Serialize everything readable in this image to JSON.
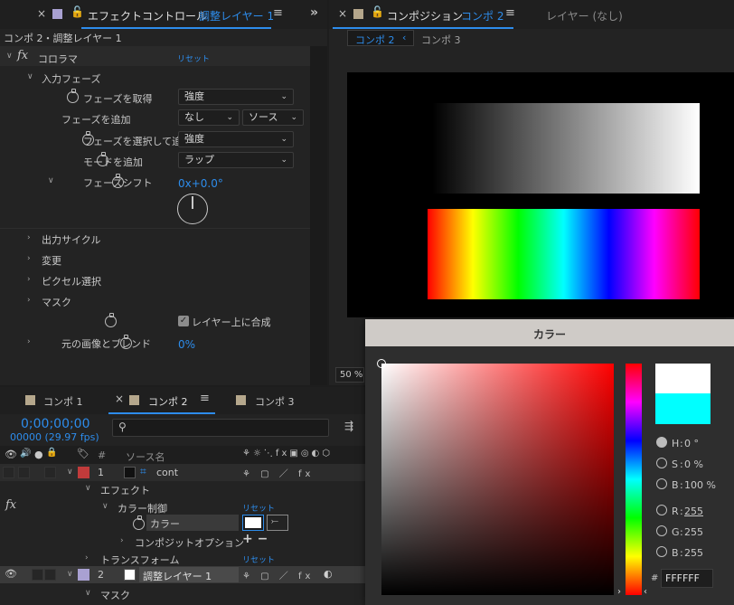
{
  "effect_panel": {
    "tab_title": "エフェクトコントロール",
    "tab_layer": "調整レイヤー 1",
    "breadcrumb": "コンポ 2・調整レイヤー 1",
    "fx_label": "fx",
    "effect_name": "コロラマ",
    "reset": "リセット",
    "input_phase": "入力フェーズ",
    "get_phase_label": "フェーズを取得",
    "get_phase_value": "強度",
    "add_phase_label": "フェーズを追加",
    "add_phase_value": "なし",
    "add_phase_source": "ソース",
    "select_phase_label": "フェーズを選択して追",
    "select_phase_value": "強度",
    "add_mode_label": "モードを追加",
    "add_mode_value": "ラップ",
    "phase_shift_label": "フェーズシフト",
    "phase_shift_value": "0x+0.0°",
    "output_cycle": "出力サイクル",
    "modify": "変更",
    "pixel_select": "ピクセル選択",
    "mask": "マスク",
    "composite_label": "レイヤー上に合成",
    "blend_label": "元の画像とブレンド",
    "blend_value": "0%"
  },
  "comp_panel": {
    "tab_title": "コンポジション",
    "tab_comp": "コンポ 2",
    "layer_tab": "レイヤー (なし)",
    "crumb_active": "コンポ 2",
    "crumb_other": "コンポ 3",
    "zoom": "50 %"
  },
  "timeline": {
    "tabs": [
      "コンポ 1",
      "コンポ 2",
      "コンポ 3"
    ],
    "timecode": "0;00;00;00",
    "fps": "00000 (29.97 fps)",
    "col_num": "#",
    "col_source": "ソース名",
    "layer1_num": "1",
    "layer1_name": "cont",
    "effect": "エフェクト",
    "fx_label": "fx",
    "color_control": "カラー制御",
    "reset": "リセット",
    "color_prop": "カラー",
    "composite_options": "コンポジットオプション",
    "plus_minus": "+ −",
    "transform": "トランスフォーム",
    "transform_reset": "リセット",
    "layer2_num": "2",
    "layer2_name": "調整レイヤー 1",
    "mask": "マスク"
  },
  "color_dialog": {
    "title": "カラー",
    "h_label": "H",
    "h_value": "0 °",
    "s_label": "S",
    "s_value": "0 %",
    "b_label": "B",
    "b_value": "100 %",
    "r_label": "R",
    "r_value": "255",
    "g_label": "G",
    "g_value": "255",
    "b2_label": "B",
    "b2_value": "255",
    "hash": "#",
    "hex": "FFFFFF",
    "new_color": "#ffffff",
    "old_color": "#00ffff"
  }
}
